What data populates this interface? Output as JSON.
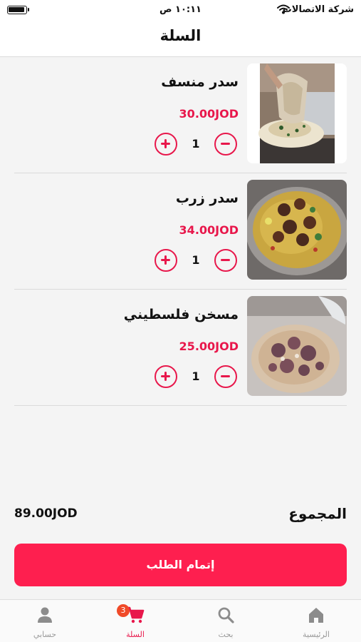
{
  "status_bar": {
    "carrier": "شركة الاتصالات",
    "time": "١٠:١١ ص"
  },
  "header": {
    "title": "السلة"
  },
  "cart": {
    "items": [
      {
        "name": "سدر منسف",
        "price": "30.00JOD",
        "quantity": "1"
      },
      {
        "name": "سدر زرب",
        "price": "34.00JOD",
        "quantity": "1"
      },
      {
        "name": "مسخن فلسطيني",
        "price": "25.00JOD",
        "quantity": "1"
      }
    ]
  },
  "summary": {
    "total_label": "المجموع",
    "total_value": "89.00JOD"
  },
  "checkout": {
    "label": "إتمام الطلب"
  },
  "tab_bar": {
    "tabs": [
      {
        "label": "الرئيسية",
        "icon": "home-icon"
      },
      {
        "label": "بحث",
        "icon": "search-icon"
      },
      {
        "label": "السلة",
        "icon": "cart-icon",
        "badge": "3",
        "active": true
      },
      {
        "label": "حسابي",
        "icon": "person-icon"
      }
    ]
  },
  "colors": {
    "accent": "#e8174b",
    "checkout_button": "#fe1f4f",
    "badge": "#f04a28",
    "background": "#f4f4f4"
  }
}
